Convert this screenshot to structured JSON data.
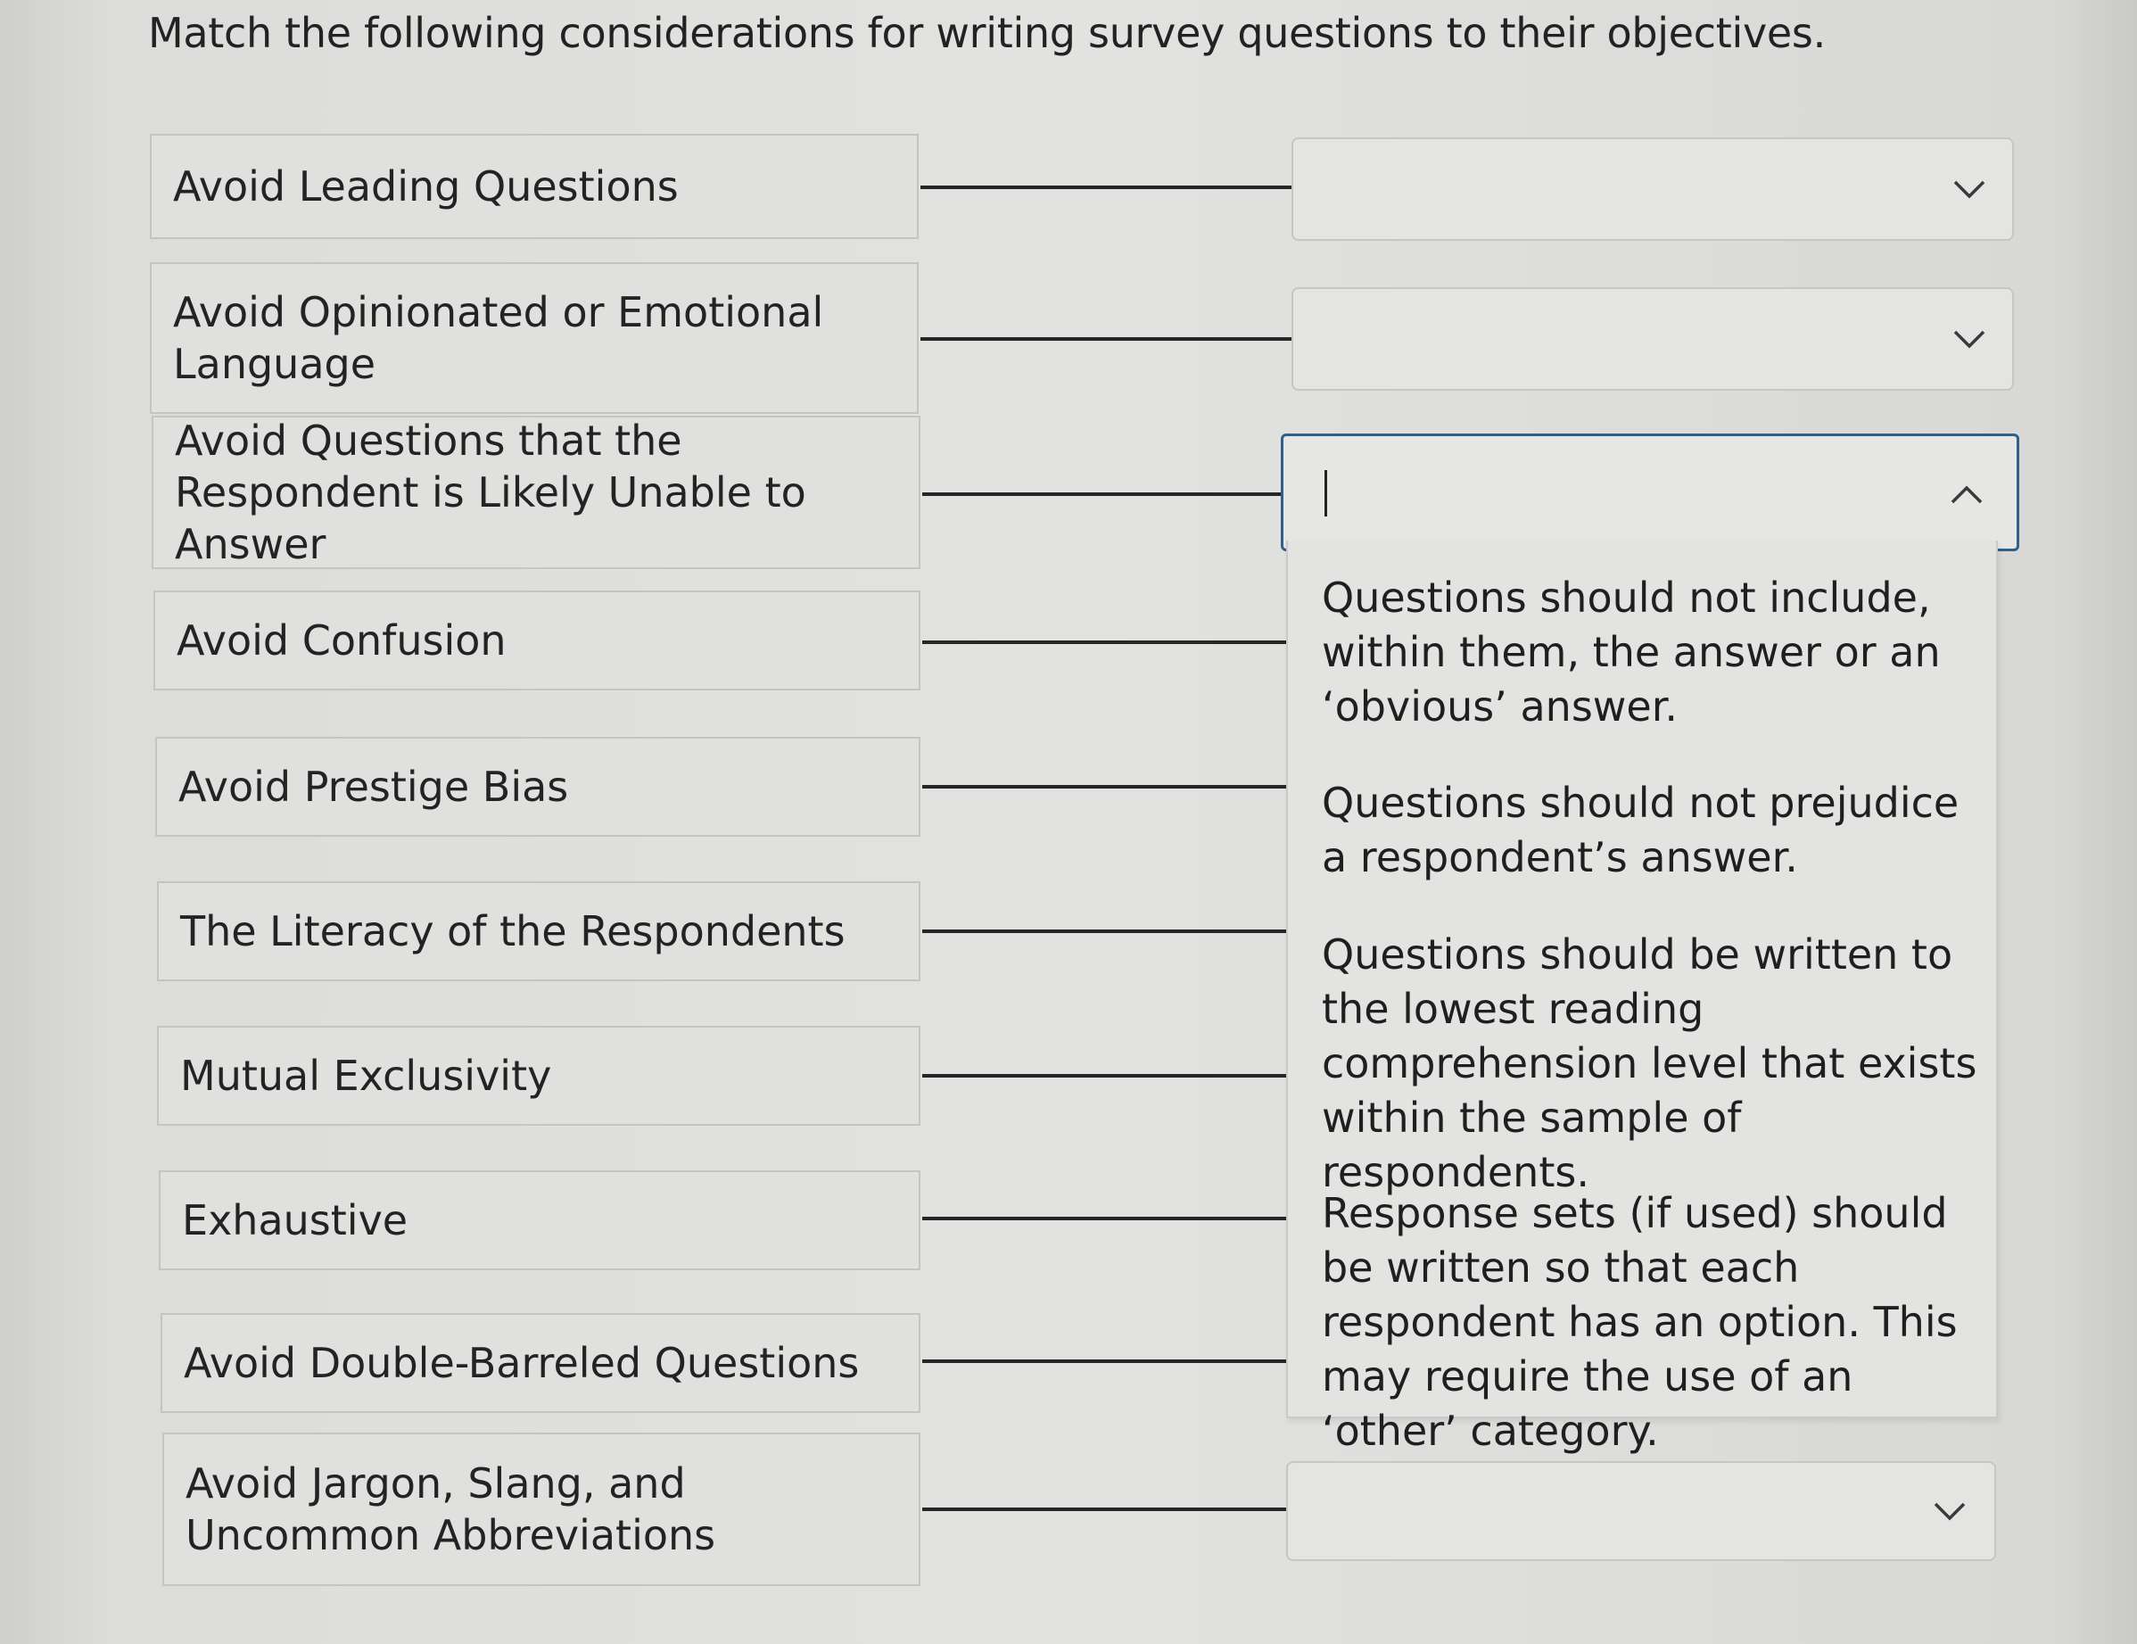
{
  "question": {
    "title": "Match the following considerations for writing survey questions to their objectives."
  },
  "terms": [
    "Avoid Leading Questions",
    "Avoid Opinionated or Emotional Language",
    "Avoid Questions that the Respondent is Likely Unable to Answer",
    "Avoid Confusion",
    "Avoid Prestige Bias",
    "The Literacy of the Respondents",
    "Mutual Exclusivity",
    "Exhaustive",
    "Avoid Double-Barreled Questions",
    "Avoid Jargon, Slang, and Uncommon Abbreviations"
  ],
  "selects": [
    {
      "value": "",
      "state": "collapsed",
      "icon": "chevron-down-icon"
    },
    {
      "value": "",
      "state": "collapsed",
      "icon": "chevron-down-icon"
    },
    {
      "value": "",
      "state": "open",
      "icon": "chevron-up-icon"
    },
    {
      "value": "",
      "state": "collapsed",
      "icon": "chevron-down-icon"
    }
  ],
  "dropdown_options": [
    "Questions should not include, within them, the answer or an ‘obvious’ answer.",
    "Questions should not prejudice a respondent’s answer.",
    "Questions should be written to the lowest reading comprehension level that exists within the sample of respondents.",
    "Response sets (if used) should be written so that each respondent has an option. This may require the use of an ‘other’ category."
  ],
  "colors": {
    "focus_border": "#2f5f8a",
    "connector": "#262626",
    "box_fill": "#e0e0de"
  }
}
